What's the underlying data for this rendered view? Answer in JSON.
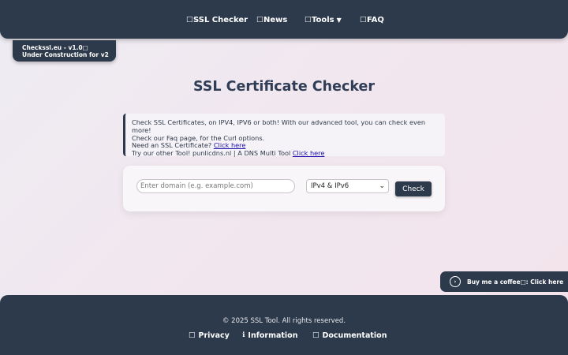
{
  "nav": {
    "items": [
      {
        "icon": "□",
        "label": "SSL Checker"
      },
      {
        "icon": "□",
        "label": "News"
      },
      {
        "icon": "□",
        "label": "Tools",
        "caret": "▼"
      },
      {
        "icon": "□",
        "label": "FAQ"
      }
    ]
  },
  "badge": {
    "line1": "Checkssl.eu - v1.0□",
    "line2": "Under Construction for v2"
  },
  "title": "SSL Certificate Checker",
  "info": {
    "line1": "Check SSL Certificates, on IPV4, IPV6 or both! With our advanced tool, you can check even more!",
    "line2": "Check our Faq page, for the Curl options.",
    "line3_text": "Need an SSL Certificate? ",
    "line3_link": "Click here",
    "line4_text": "Try our other Tool! punlicdns.nl | A DNS Multi Tool ",
    "line4_link": "Click here"
  },
  "form": {
    "domain_placeholder": "Enter domain (e.g. example.com)",
    "domain_value": "",
    "ip_selected": "IPv4 & IPv6",
    "check_label": "Check"
  },
  "coffee": {
    "label": "Buy me a coffee□: Click here"
  },
  "footer": {
    "copyright": "© 2025 SSL Tool. All rights reserved.",
    "links": [
      {
        "icon": "□",
        "label": "Privacy"
      },
      {
        "icon": "ℹ",
        "label": "Information"
      },
      {
        "icon": "□",
        "label": "Documentation"
      }
    ]
  },
  "colors": {
    "navy": "#2d3a4b",
    "title": "#2f3e56",
    "link": "#1a0dab"
  }
}
